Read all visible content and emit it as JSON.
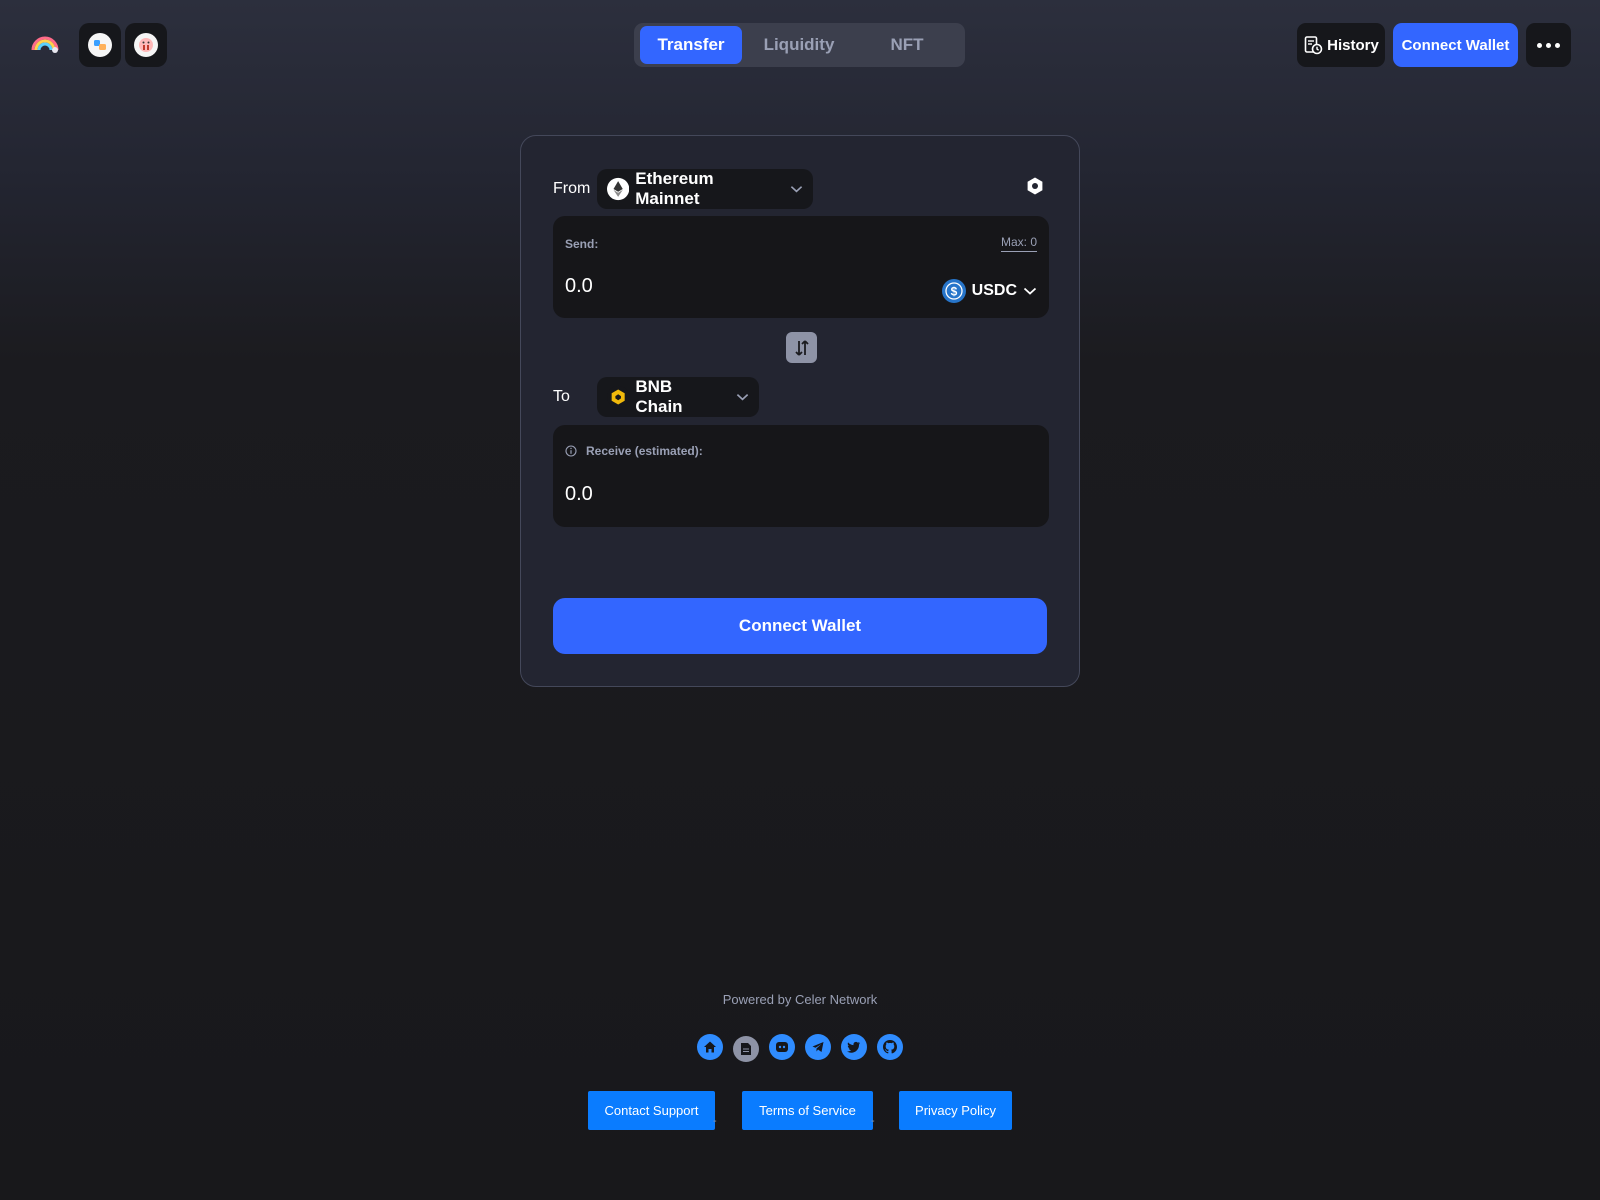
{
  "header": {
    "logo_icon": "rainbow-logo-icon",
    "apps": [
      {
        "icon": "app-cbridge-icon"
      },
      {
        "icon": "app-pig-icon"
      }
    ],
    "tabs": [
      {
        "label": "Transfer",
        "active": true
      },
      {
        "label": "Liquidity",
        "active": false
      },
      {
        "label": "NFT",
        "active": false
      }
    ],
    "history_label": "History",
    "connect_wallet_label": "Connect Wallet",
    "more_icon": "more-dots-icon"
  },
  "transfer": {
    "from_label": "From",
    "from_chain": "Ethereum Mainnet",
    "send_label": "Send:",
    "max_label": "Max: 0",
    "send_placeholder": "0.0",
    "token_symbol": "USDC",
    "to_label": "To",
    "to_chain": "BNB Chain",
    "receive_label": "Receive (estimated):",
    "receive_value": "0.0",
    "connect_wallet_label": "Connect Wallet"
  },
  "footer": {
    "powered_by": "Powered by Celer Network",
    "socials": [
      "home-icon",
      "docs-icon",
      "discord-icon",
      "telegram-icon",
      "twitter-icon",
      "github-icon"
    ],
    "links": [
      "Contact Support",
      "Terms of Service",
      "Privacy Policy"
    ],
    "separator": "-"
  },
  "colors": {
    "accent": "#3366ff",
    "link_button": "#0a7cff",
    "card_bg": "#232531",
    "panel_bg": "#161619",
    "muted_text": "#9aa0b5"
  }
}
